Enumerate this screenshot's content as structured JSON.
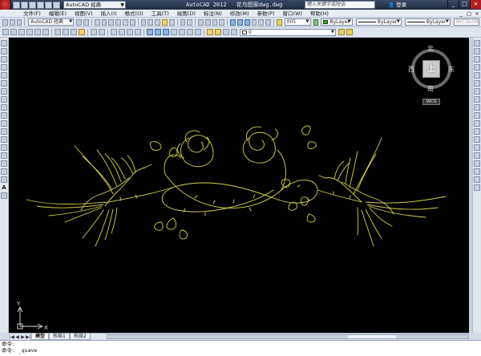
{
  "titlebar": {
    "workspace": "AutoCAD 经典",
    "app_name": "AutoCAD 2012",
    "file_name": "花鸟图案dwg.dwg",
    "search_placeholder": "键入关键字或短语",
    "signin_label": "登录",
    "minimize": "_",
    "maximize": "□",
    "close": "×"
  },
  "menubar": {
    "items": [
      "文件(F)",
      "编辑(E)",
      "视图(V)",
      "插入(I)",
      "格式(O)",
      "工具(T)",
      "绘图(D)",
      "标注(N)",
      "修改(M)",
      "参数(P)",
      "窗口(W)",
      "帮助(H)"
    ],
    "right_controls": [
      "_",
      "□",
      "×"
    ]
  },
  "toolbar2": {
    "workspace_combo": "AutoCAD 经典",
    "text_style": "005",
    "color_value": "ByLayer",
    "linetype_value": "ByLayer",
    "lineweight_value": "ByLayer",
    "plotstyle_value": "BYCOLOR"
  },
  "toolbar3": {
    "layer_value": "0"
  },
  "viewcube": {
    "north": "北",
    "south": "南",
    "east": "东",
    "west": "西",
    "top_face": "上",
    "wcs": "WCS"
  },
  "ucs": {
    "x_label": "X",
    "y_label": "Y"
  },
  "tabs": {
    "items": [
      "模型",
      "布局1",
      "布局2"
    ],
    "active": "模型"
  },
  "command": {
    "line1": "命令:",
    "line2": "命令: _qsave"
  },
  "colors": {
    "drawing_stroke": "#d6d24a",
    "canvas_bg": "#000000",
    "accent": "#3a4a66"
  }
}
